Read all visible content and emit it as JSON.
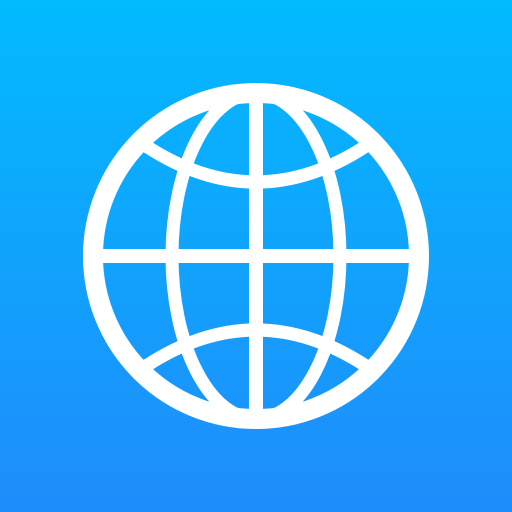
{
  "app_icon": {
    "icon": "globe-icon",
    "colors": {
      "gradient_top": "#02BAFE",
      "gradient_bottom": "#1F8CFB",
      "glyph": "#FFFFFF"
    }
  }
}
